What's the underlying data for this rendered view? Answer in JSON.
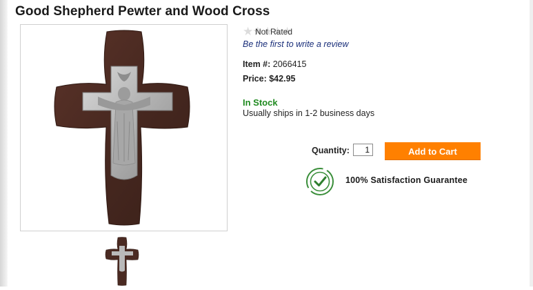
{
  "product": {
    "title": "Good Shepherd Pewter and Wood Cross",
    "rating": {
      "stars": 0,
      "max": 5,
      "label": "Not Rated"
    },
    "review_link": "Be the first to write a review",
    "item_label": "Item #:",
    "item_number": "2066415",
    "price_label": "Price:",
    "price": "$42.95",
    "stock_status": "In Stock",
    "shipping": "Usually ships in 1-2 business days"
  },
  "purchase": {
    "quantity_label": "Quantity:",
    "quantity_value": "1",
    "add_to_cart": "Add to Cart"
  },
  "guarantee": {
    "text": "100% Satisfaction Guarantee"
  },
  "colors": {
    "brand_orange": "#ff8000",
    "stock_green": "#1f8a1f",
    "link_blue": "#1a2f7a",
    "wood": "#4a2a22",
    "pewter": "#bdbdbd"
  },
  "icons": {
    "rating": "star-icon",
    "guarantee": "checkmark-badge-icon"
  }
}
